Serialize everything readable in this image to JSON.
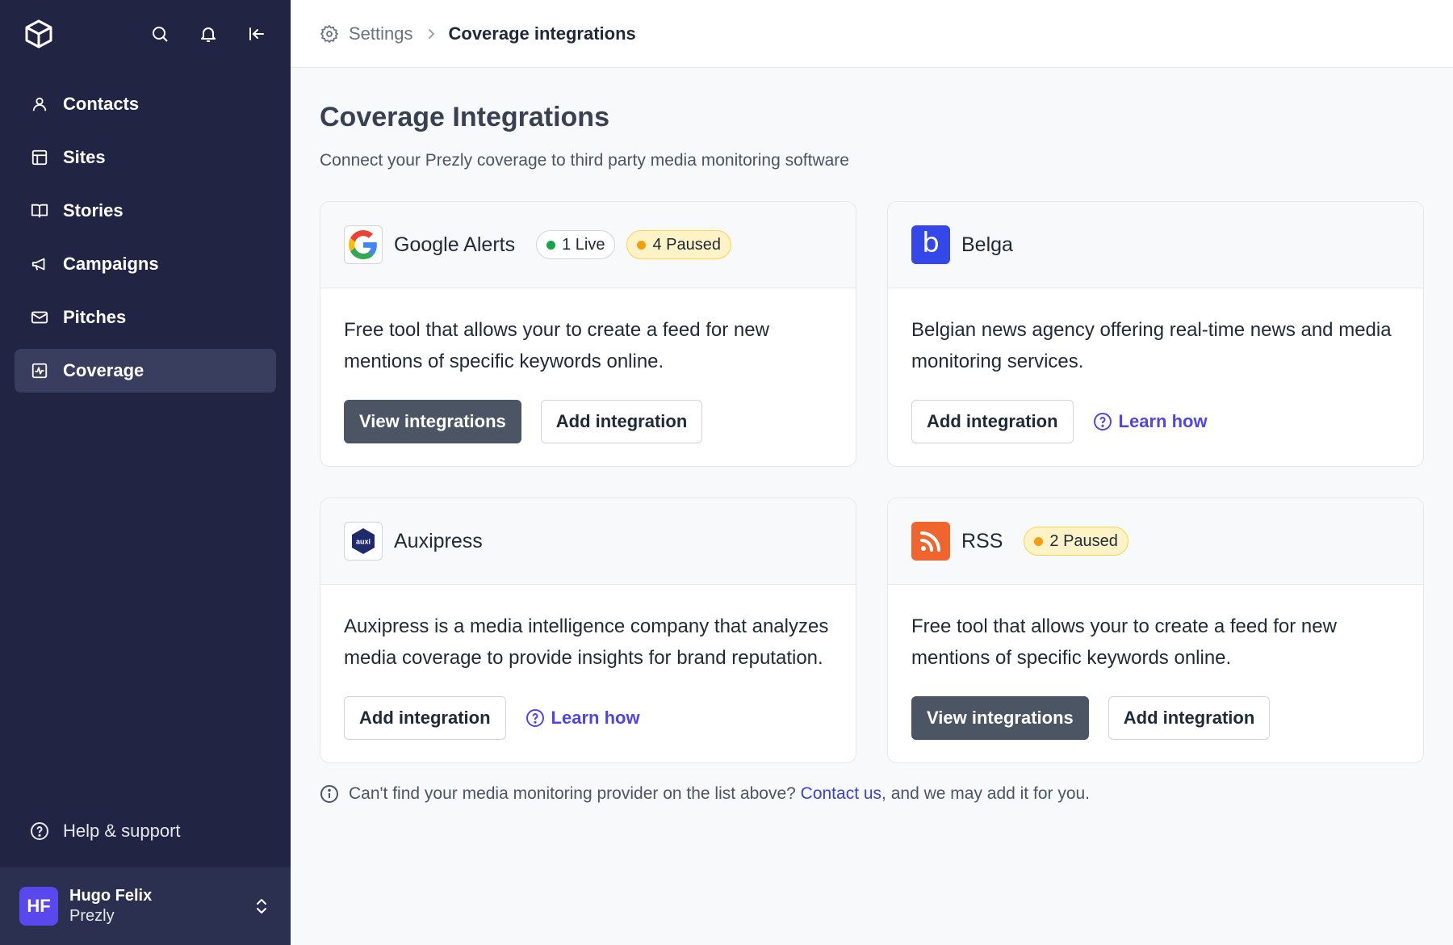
{
  "sidebar": {
    "items": [
      {
        "label": "Contacts",
        "icon": "user-icon"
      },
      {
        "label": "Sites",
        "icon": "layout-icon"
      },
      {
        "label": "Stories",
        "icon": "book-icon"
      },
      {
        "label": "Campaigns",
        "icon": "megaphone-icon"
      },
      {
        "label": "Pitches",
        "icon": "mail-icon"
      },
      {
        "label": "Coverage",
        "icon": "chart-icon",
        "active": true
      }
    ],
    "help_label": "Help & support",
    "user": {
      "initials": "HF",
      "name": "Hugo Felix",
      "org": "Prezly"
    }
  },
  "breadcrumb": {
    "parent": "Settings",
    "current": "Coverage integrations"
  },
  "page": {
    "title": "Coverage Integrations",
    "subtitle": "Connect your Prezly coverage to third party media monitoring software"
  },
  "cards": [
    {
      "name": "Google Alerts",
      "badges": [
        {
          "label": "1 Live"
        },
        {
          "label": "4 Paused"
        }
      ],
      "description": "Free tool that allows your to create a feed for new mentions of specific keywords online.",
      "primary": "View integrations",
      "secondary": "Add integration"
    },
    {
      "name": "Belga",
      "description": "Belgian news agency offering real-time news and media monitoring services.",
      "secondary": "Add integration",
      "learn": "Learn how",
      "logo_text": "b"
    },
    {
      "name": "Auxipress",
      "description": "Auxipress is a media intelligence company that analyzes media coverage to provide insights for brand reputation.",
      "secondary": "Add integration",
      "learn": "Learn how",
      "logo_text": "auxi"
    },
    {
      "name": "RSS",
      "badges": [
        {
          "label": "2 Paused"
        }
      ],
      "description": "Free tool that allows your to create a feed for new mentions of specific keywords online.",
      "primary": "View integrations",
      "secondary": "Add integration"
    }
  ],
  "footnote": {
    "before": "Can't find your media monitoring provider on the list above? ",
    "link": "Contact us",
    "after": ", and we may add it for you."
  },
  "colors": {
    "sidebar_bg": "#212543",
    "accent": "#4f46e5",
    "live": "#16a34a",
    "paused": "#f59e0b",
    "belga": "#3447e8",
    "rss": "#f0652d"
  }
}
